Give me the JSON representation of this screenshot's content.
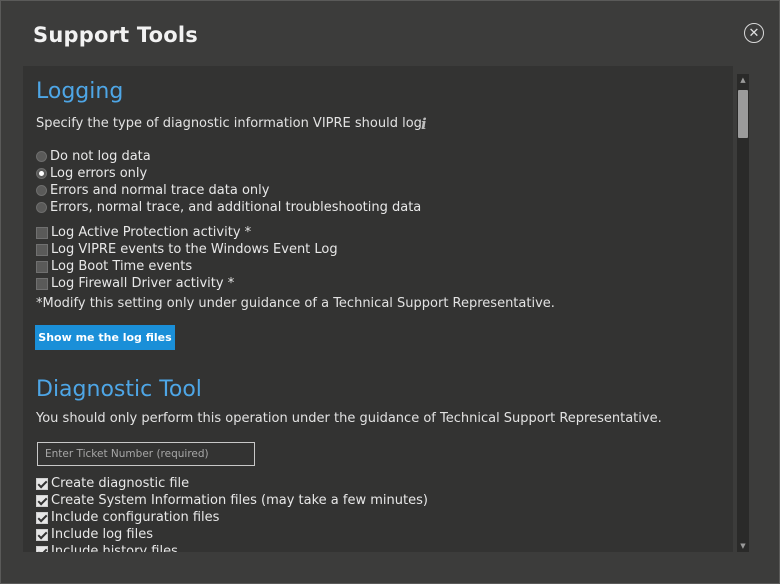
{
  "window": {
    "title": "Support Tools",
    "close_label": "✕"
  },
  "logging": {
    "heading": "Logging",
    "description": "Specify the type of diagnostic information VIPRE should log.",
    "info_glyph": "i",
    "radios": [
      {
        "label": "Do not log data",
        "selected": false
      },
      {
        "label": "Log errors only",
        "selected": true
      },
      {
        "label": "Errors and normal trace data only",
        "selected": false
      },
      {
        "label": "Errors, normal trace, and additional troubleshooting data",
        "selected": false
      }
    ],
    "checkboxes": [
      {
        "label": "Log Active Protection activity *",
        "checked": false
      },
      {
        "label": "Log VIPRE events to the Windows Event Log",
        "checked": false
      },
      {
        "label": "Log Boot Time events",
        "checked": false
      },
      {
        "label": "Log Firewall Driver activity *",
        "checked": false
      }
    ],
    "note": "*Modify this setting only under guidance of a Technical Support Representative.",
    "button_label": "Show me the log files"
  },
  "diagnostic": {
    "heading": "Diagnostic Tool",
    "description": "You should only perform this operation under the guidance of Technical Support Representative.",
    "ticket_placeholder": "Enter Ticket Number (required)",
    "ticket_value": "",
    "checkboxes": [
      {
        "label": "Create diagnostic file",
        "checked": true
      },
      {
        "label": "Create System Information files (may take a few minutes)",
        "checked": true
      },
      {
        "label": "Include configuration files",
        "checked": true
      },
      {
        "label": "Include log files",
        "checked": true
      },
      {
        "label": "Include history files",
        "checked": true
      }
    ]
  },
  "scrollbar": {
    "up_glyph": "▲",
    "down_glyph": "▼"
  },
  "colors": {
    "accent": "#4ea6e6",
    "button": "#1a8fd8",
    "background": "#3c3c3b"
  }
}
